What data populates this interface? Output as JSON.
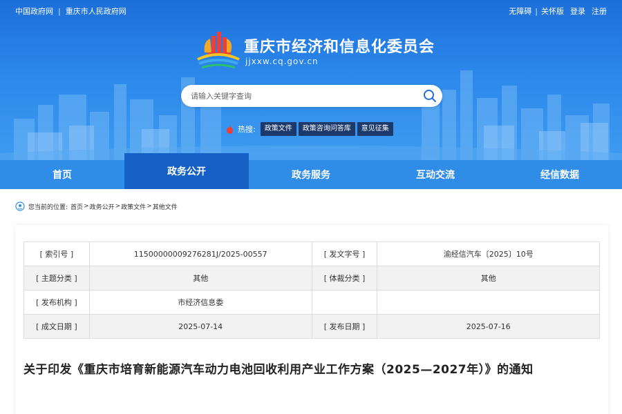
{
  "topbar": {
    "left_links": [
      "中国政府网",
      "重庆市人民政府网"
    ],
    "right_links": [
      "无障碍",
      "关怀版",
      "登录",
      "注册"
    ]
  },
  "site": {
    "title": "重庆市经济和信息化委员会",
    "domain": "jjxxw.cq.gov.cn"
  },
  "search": {
    "placeholder": "请输入关键字查询"
  },
  "hot": {
    "label": "热搜:",
    "tags": [
      "政策文件",
      "政策咨询问答库",
      "意见征集"
    ]
  },
  "nav": {
    "items": [
      {
        "label": "首页"
      },
      {
        "label": "政务公开"
      },
      {
        "label": "政务服务"
      },
      {
        "label": "互动交流"
      },
      {
        "label": "经信数据"
      }
    ]
  },
  "breadcrumb": {
    "prefix": "您当前的位置:",
    "items": [
      "首页",
      "政务公开",
      "政策文件",
      "其他文件"
    ]
  },
  "meta": {
    "rows": [
      {
        "l1": "[ 索引号 ]",
        "v1": "11500000009276281J/2025-00557",
        "l2": "[ 发文字号 ]",
        "v2": "渝经信汽车〔2025〕10号"
      },
      {
        "l1": "[ 主题分类 ]",
        "v1": "其他",
        "l2": "[ 体裁分类 ]",
        "v2": "其他"
      },
      {
        "l1": "[ 发布机构 ]",
        "v1": "市经济信息委",
        "l2": "",
        "v2": ""
      },
      {
        "l1": "[ 成文日期 ]",
        "v1": "2025-07-14",
        "l2": "[ 发布日期 ]",
        "v2": "2025-07-16"
      }
    ]
  },
  "document": {
    "title": "关于印发《重庆市培育新能源汽车动力电池回收利用产业工作方案（2025—2027年）》的通知"
  },
  "colors": {
    "header_blue": "#2b87ea",
    "nav_blue": "#2f8de8",
    "nav_active": "#1560c4",
    "hot_tag_bg": "#1b3a6b"
  }
}
